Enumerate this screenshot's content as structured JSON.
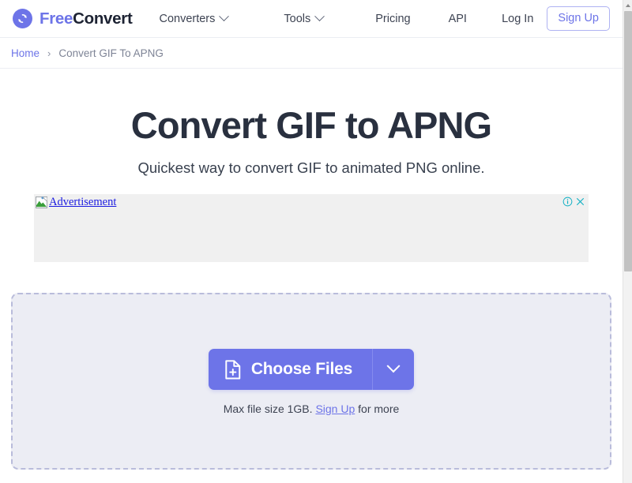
{
  "brand": {
    "logo_icon": "refresh-circle-icon",
    "name_part1": "Free",
    "name_part2": "Convert"
  },
  "navbar": {
    "items": [
      {
        "label": "Converters",
        "has_dropdown": true,
        "icon": "chevron-down-icon"
      },
      {
        "label": "Tools",
        "has_dropdown": true,
        "icon": "chevron-down-icon"
      },
      {
        "label": "Pricing",
        "has_dropdown": false
      },
      {
        "label": "API",
        "has_dropdown": false
      }
    ],
    "login_label": "Log In",
    "signup_label": "Sign Up",
    "accent_color": "#6d74e8"
  },
  "breadcrumb": {
    "home_label": "Home",
    "separator": "›",
    "current_label": "Convert GIF To APNG"
  },
  "hero": {
    "title": "Convert GIF to APNG",
    "subtitle": "Quickest way to convert GIF to animated PNG online."
  },
  "advertisement": {
    "alt_text": "Advertisement",
    "broken_image_icon": "broken-image-icon",
    "info_icon": "ⓘ",
    "close_icon": "✕",
    "control_color": "#12b0c4",
    "background_color": "#f0f0f0"
  },
  "dropzone": {
    "choose_files_label": "Choose Files",
    "file_icon": "file-add-icon",
    "dropdown_icon": "chevron-down-icon",
    "max_size_prefix": "Max file size 1GB.",
    "signup_link_label": "Sign Up",
    "max_size_suffix": "for more",
    "button_color": "#6d74e8",
    "background_color": "#ecedf4",
    "border_color": "#b9bcdb"
  },
  "scrollbar": {
    "up_arrow_icon": "scroll-up-arrow-icon"
  }
}
